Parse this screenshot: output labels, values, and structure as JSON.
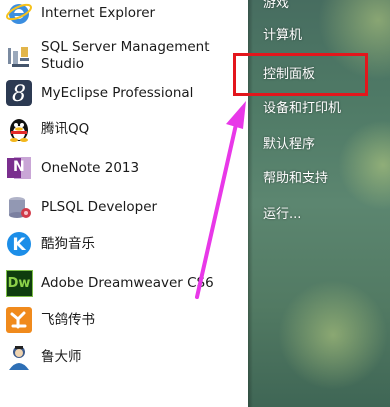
{
  "programs": [
    {
      "label": "Internet Explorer",
      "icon": "internet-explorer-icon"
    },
    {
      "label": "SQL Server Management Studio",
      "icon": "sql-server-icon"
    },
    {
      "label": "MyEclipse Professional",
      "icon": "myeclipse-icon"
    },
    {
      "label": "腾讯QQ",
      "icon": "qq-icon"
    },
    {
      "label": "OneNote 2013",
      "icon": "onenote-icon"
    },
    {
      "label": "PLSQL Developer",
      "icon": "plsql-icon"
    },
    {
      "label": "酷狗音乐",
      "icon": "kugou-icon"
    },
    {
      "label": "Adobe Dreamweaver CS6",
      "icon": "dreamweaver-icon"
    },
    {
      "label": "飞鸽传书",
      "icon": "feige-icon"
    },
    {
      "label": "鲁大师",
      "icon": "ludashi-icon"
    }
  ],
  "sql_label_line1": "SQL Server Management",
  "sql_label_line2": "Studio",
  "dreamweaver_badge": "Dw",
  "onenote_badge": "N",
  "right_pane": {
    "items": [
      {
        "label": "游戏"
      },
      {
        "label": "计算机"
      },
      {
        "label": "控制面板"
      },
      {
        "label": "设备和打印机"
      },
      {
        "label": "默认程序"
      },
      {
        "label": "帮助和支持"
      },
      {
        "label": "运行..."
      }
    ]
  },
  "colors": {
    "highlight": "#e3161c",
    "arrow": "#e838e8",
    "pane_bg": "#4f7a66"
  }
}
